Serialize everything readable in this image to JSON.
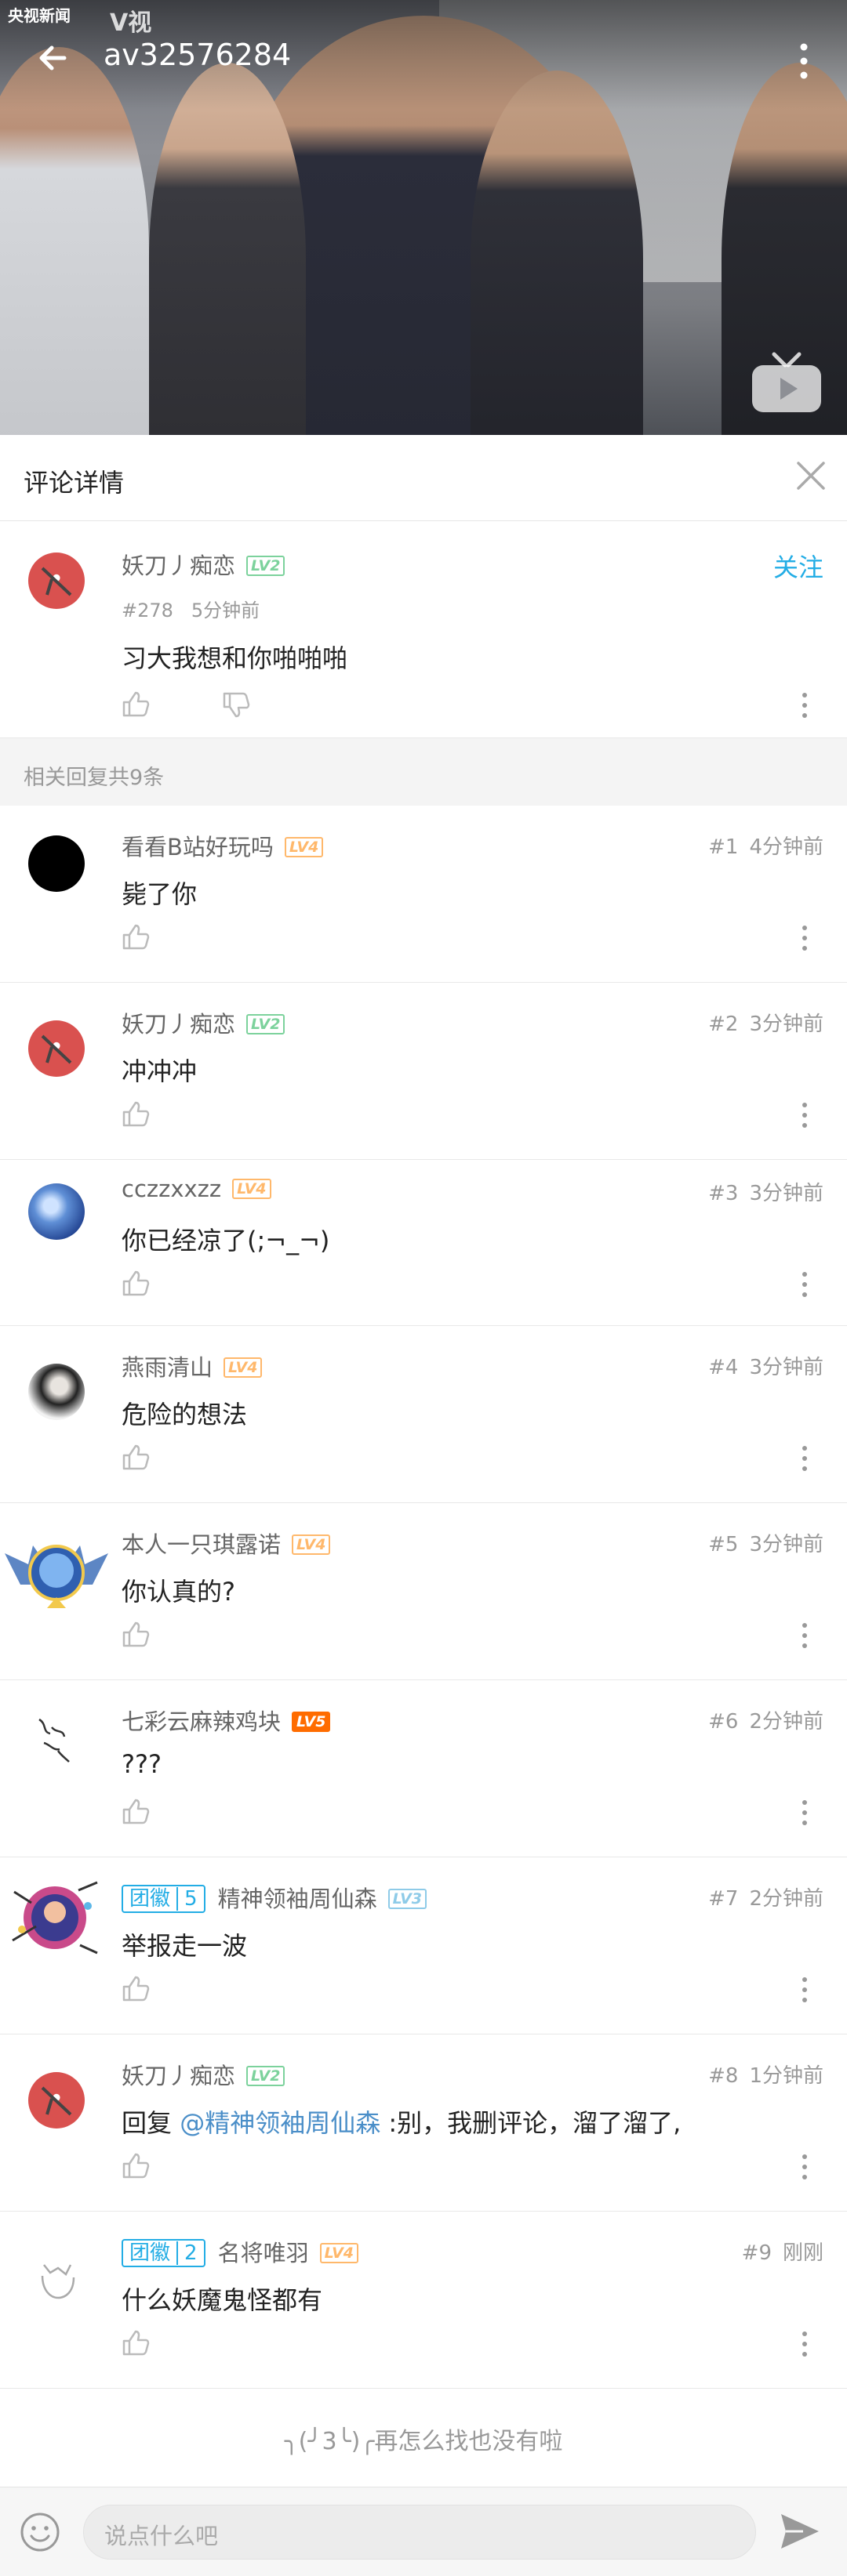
{
  "player": {
    "title": "av32576284",
    "channel_logo": "央视新闻",
    "channel_logo2": "V视"
  },
  "panel": {
    "title": "评论详情"
  },
  "main_comment": {
    "user": "妖刀丿痴恋",
    "level": "LV2",
    "floor": "#278",
    "time": "5分钟前",
    "content": "习大我想和你啪啪啪",
    "follow": "关注"
  },
  "replies_header": "相关回复共9条",
  "replies": [
    {
      "user": "看看B站好玩吗",
      "level": "LV4",
      "floor": "#1",
      "time": "4分钟前",
      "content": "毙了你"
    },
    {
      "user": "妖刀丿痴恋",
      "level": "LV2",
      "floor": "#2",
      "time": "3分钟前",
      "content": "冲冲冲"
    },
    {
      "user": "cczzxxzz",
      "level": "LV4",
      "floor": "#3",
      "time": "3分钟前",
      "content": "你已经凉了(;¬_¬)"
    },
    {
      "user": "燕雨清山",
      "level": "LV4",
      "floor": "#4",
      "time": "3分钟前",
      "content": "危险的想法"
    },
    {
      "user": "本人一只琪露诺",
      "level": "LV4",
      "floor": "#5",
      "time": "3分钟前",
      "content": "你认真的?"
    },
    {
      "user": "七彩云麻辣鸡块",
      "level": "LV5",
      "floor": "#6",
      "time": "2分钟前",
      "content": "???"
    },
    {
      "user": "精神领袖周仙森",
      "level": "LV3",
      "badge": "团徽",
      "badge_level": "5",
      "floor": "#7",
      "time": "2分钟前",
      "content": "举报走一波"
    },
    {
      "user": "妖刀丿痴恋",
      "level": "LV2",
      "floor": "#8",
      "time": "1分钟前",
      "reply_prefix": "回复 ",
      "reply_target": "@精神领袖周仙森",
      "content": " :别，我删评论，溜了溜了,"
    },
    {
      "user": "名将唯羽",
      "level": "LV4",
      "badge": "团徽",
      "badge_level": "2",
      "floor": "#9",
      "time": "刚刚",
      "content": "什么妖魔鬼怪都有"
    }
  ],
  "end_text": "╮(╯3╰)╭再怎么找也没有啦",
  "input": {
    "placeholder": "说点什么吧"
  },
  "colors": {
    "accent": "#23ade5",
    "lv2": "#7cd29c",
    "lv4": "#ffb86b",
    "lv5": "#ff6c00",
    "lv3": "#8ecbe8"
  }
}
